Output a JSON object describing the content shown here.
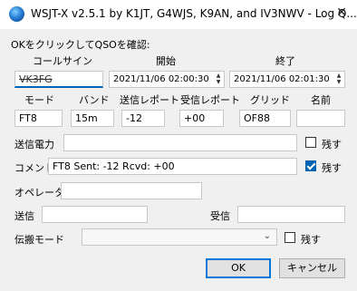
{
  "window": {
    "title": "WSJT-X   v2.5.1   by K1JT, G4WJS, K9AN, and IV3NWV - Log Q...",
    "close_glyph": "✕"
  },
  "instruction": "OKをクリックしてQSOを確認:",
  "labels": {
    "callsign": "コールサイン",
    "start": "開始",
    "end": "終了",
    "mode": "モード",
    "band": "バンド",
    "report_sent": "送信レポート",
    "report_rcvd": "受信レポート",
    "grid": "グリッド",
    "name": "名前",
    "tx_power": "送信電力",
    "comments": "コメント",
    "operator": "オペレータ",
    "sent": "送信",
    "received": "受信",
    "propagation_mode": "伝搬モード",
    "retain": "残す"
  },
  "fields": {
    "callsign": "VK3FG",
    "start": "2021/11/06 02:00:30",
    "end": "2021/11/06 02:01:30",
    "mode": "FT8",
    "band": "15m",
    "report_sent": "-12",
    "report_rcvd": "+00",
    "grid": "OF88",
    "name": "",
    "tx_power": "",
    "comments": "FT8  Sent: -12  Rcvd: +00",
    "operator": "",
    "sent": "",
    "received": "",
    "propagation_mode": ""
  },
  "checkboxes": {
    "tx_power_retain": false,
    "comments_retain": true,
    "propagation_retain": false
  },
  "buttons": {
    "ok": "OK",
    "cancel": "キャンセル"
  },
  "icons": {
    "app": "wsjtx-globe-icon",
    "close": "close-icon",
    "dropdown": "chevron-down-icon",
    "spinner": "spinner-arrows-icon"
  },
  "colors": {
    "accent": "#0063b1",
    "window_bg": "#f0f0f0",
    "titlebar_bg": "#ffffff"
  }
}
